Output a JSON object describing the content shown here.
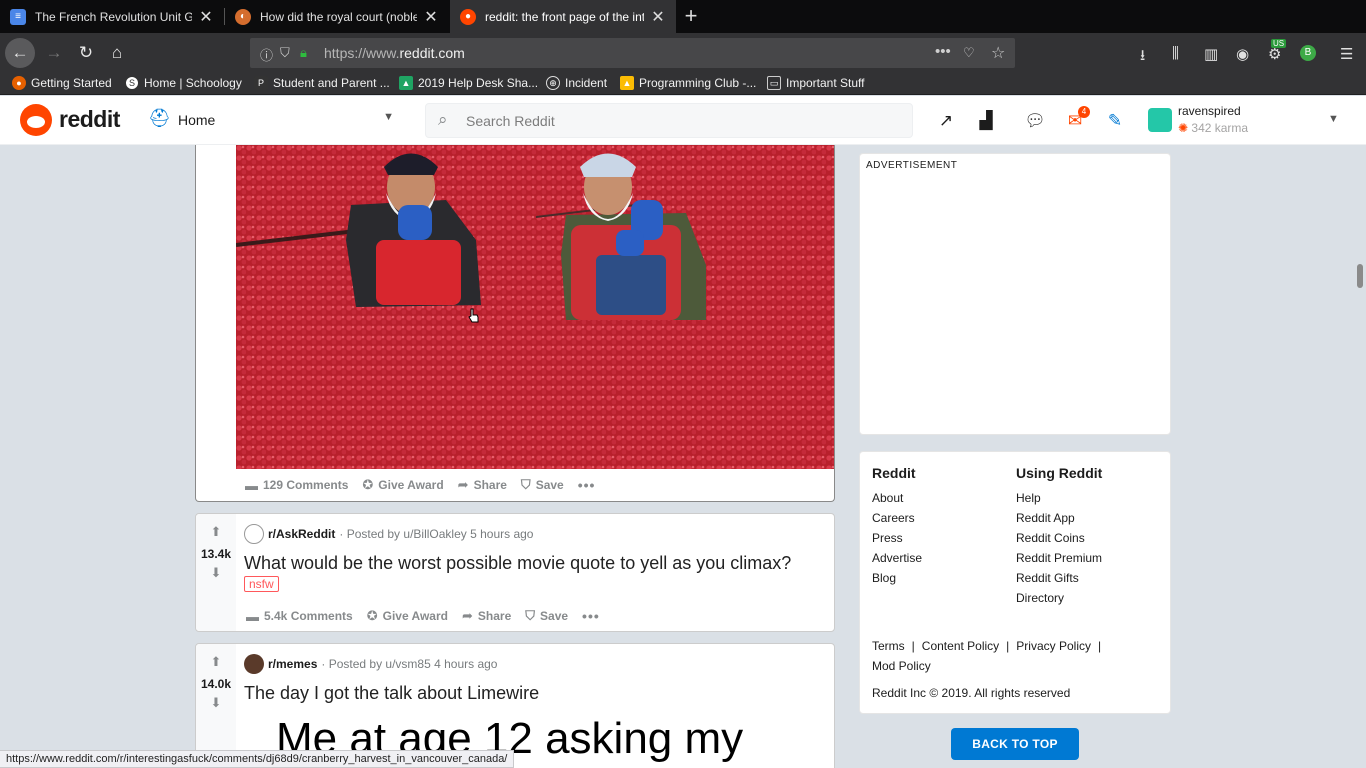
{
  "browser": {
    "tabs": [
      {
        "title": "The French Revolution Unit Gui",
        "icon": "docs-icon",
        "color": "#4a86e8"
      },
      {
        "title": "How did the royal court (nobles",
        "icon": "askhistorians-icon",
        "color": "#d46d2e"
      },
      {
        "title": "reddit: the front page of the int",
        "icon": "reddit-icon",
        "color": "#ff4500"
      }
    ],
    "url_prefix": "https://www.",
    "url_domain": "reddit.com",
    "bookmarks": [
      "Getting Started",
      "Home | Schoology",
      "Student and Parent ...",
      "2019 Help Desk Sha...",
      "Incident",
      "Programming Club -...",
      "Important Stuff"
    ],
    "account_badge": "US",
    "profile_letter": "B",
    "status_url": "https://www.reddit.com/r/interestingasfuck/comments/dj68d9/cranberry_harvest_in_vancouver_canada/"
  },
  "reddit": {
    "logo_text": "reddit",
    "home_label": "Home",
    "search_placeholder": "Search Reddit",
    "mail_count": "4",
    "username": "ravenspired",
    "karma": "342 karma"
  },
  "posts": [
    {
      "comments": "129 Comments",
      "award": "Give Award",
      "share": "Share",
      "save": "Save"
    },
    {
      "votes": "13.4k",
      "subreddit": "r/AskReddit",
      "posted_by": "· Posted by u/BillOakley 5 hours ago",
      "title": "What would be the worst possible movie quote to yell as you climax?",
      "tag": "nsfw",
      "comments": "5.4k Comments",
      "award": "Give Award",
      "share": "Share",
      "save": "Save"
    },
    {
      "votes": "14.0k",
      "subreddit": "r/memes",
      "posted_by": "· Posted by u/vsm85 4 hours ago",
      "title": "The day I got the talk about Limewire",
      "image_text": "Me at age 12 asking my"
    }
  ],
  "sidebar": {
    "ad_label": "ADVERTISEMENT",
    "col1_head": "Reddit",
    "col1": [
      "About",
      "Careers",
      "Press",
      "Advertise",
      "Blog"
    ],
    "col2_head": "Using Reddit",
    "col2": [
      "Help",
      "Reddit App",
      "Reddit Coins",
      "Reddit Premium",
      "Reddit Gifts",
      "Directory"
    ],
    "policy": [
      "Terms",
      "Content Policy",
      "Privacy Policy",
      "Mod Policy"
    ],
    "copyright": "Reddit Inc © 2019. All rights reserved",
    "back_to_top": "BACK TO TOP"
  }
}
